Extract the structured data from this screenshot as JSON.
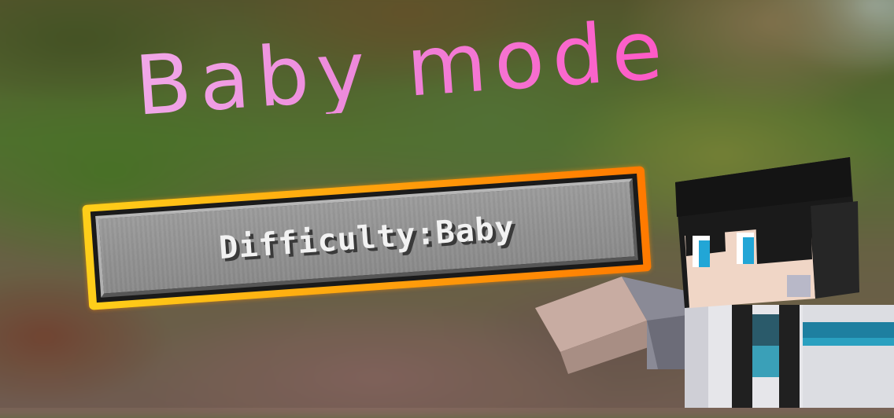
{
  "title": "Baby mode",
  "difficulty_button": {
    "label": "Difficulty:Baby"
  },
  "colors": {
    "title_gradient_start": "#f0a8e8",
    "title_gradient_end": "#ff58c6",
    "button_outline": "#ff9a0a",
    "button_face": "#8a8a8a",
    "button_text": "#f2f2f2"
  },
  "character": {
    "icon": "minecraft-player-skin"
  }
}
